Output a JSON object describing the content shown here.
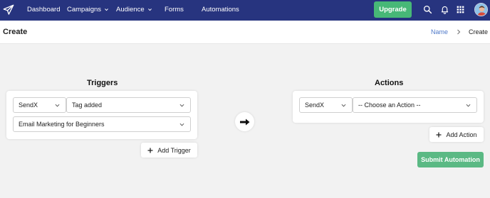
{
  "nav": {
    "items": [
      {
        "label": "Dashboard"
      },
      {
        "label": "Campaigns"
      },
      {
        "label": "Audience"
      },
      {
        "label": "Forms"
      },
      {
        "label": "Automations"
      }
    ],
    "upgrade_label": "Upgrade"
  },
  "header": {
    "title": "Create",
    "breadcrumb": {
      "name": "Name",
      "current": "Create"
    }
  },
  "triggers": {
    "title": "Triggers",
    "source_select": "SendX",
    "event_select": "Tag added",
    "tag_select": "Email Marketing for Beginners",
    "add_label": "Add Trigger"
  },
  "actions": {
    "title": "Actions",
    "source_select": "SendX",
    "action_select": "-- Choose an Action --",
    "add_label": "Add Action",
    "submit_label": "Submit Automation"
  },
  "icons": {
    "logo": "paper-plane-icon",
    "search": "search-icon",
    "notifications": "bell-icon",
    "apps": "grid-icon",
    "avatar": "user-avatar",
    "flow_arrow": "arrow-right-icon"
  },
  "colors": {
    "topbar": "#27347f",
    "upgrade": "#47b877",
    "submit": "#5bb984",
    "link": "#4f79c9",
    "background": "#f2f2f2"
  }
}
